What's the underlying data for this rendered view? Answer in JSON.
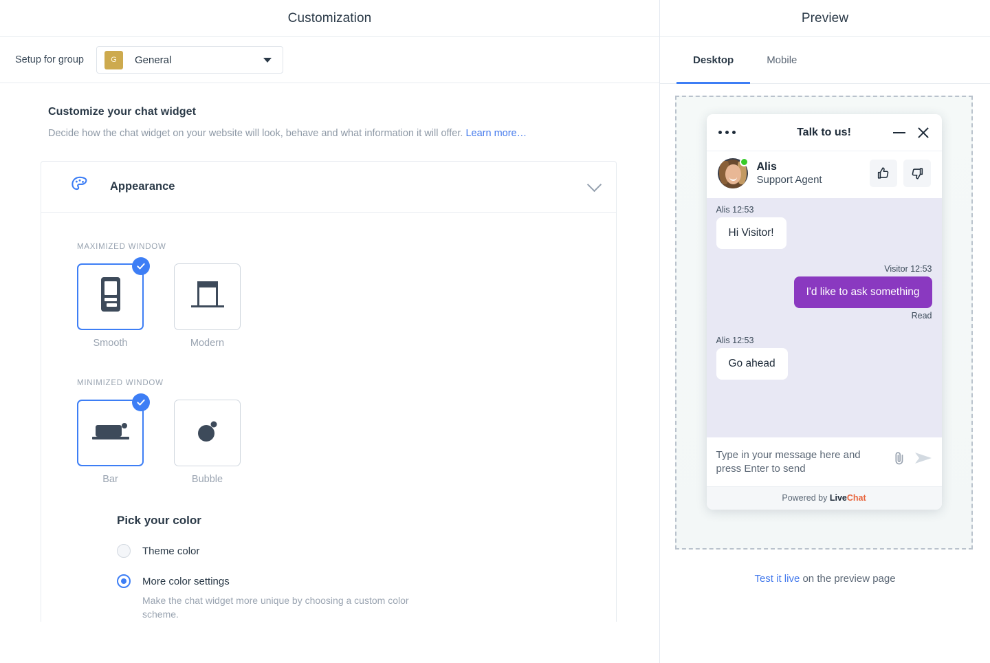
{
  "left": {
    "pane_title": "Customization",
    "group": {
      "label": "Setup for group",
      "badge": "G",
      "value": "General",
      "caret_icon": "chevron-down-icon"
    },
    "section": {
      "heading": "Customize your chat widget",
      "description": "Decide how the chat widget on your website will look, behave and what information it will offer.",
      "learn_more": "Learn more…"
    },
    "appearance_card": {
      "icon": "palette-icon",
      "title": "Appearance",
      "collapse_icon": "chevron-down-icon",
      "maximized": {
        "label": "MAXIMIZED WINDOW",
        "options": [
          {
            "caption": "Smooth",
            "icon": "smooth-window-icon",
            "selected": true
          },
          {
            "caption": "Modern",
            "icon": "modern-window-icon",
            "selected": false
          }
        ]
      },
      "minimized": {
        "label": "MINIMIZED WINDOW",
        "options": [
          {
            "caption": "Bar",
            "icon": "bar-minimized-icon",
            "selected": true
          },
          {
            "caption": "Bubble",
            "icon": "bubble-minimized-icon",
            "selected": false
          }
        ]
      },
      "pick_color": {
        "title": "Pick your color",
        "options": [
          {
            "label": "Theme color",
            "selected": false,
            "help": ""
          },
          {
            "label": "More color settings",
            "selected": true,
            "help": "Make the chat widget more unique by choosing a custom color scheme."
          }
        ]
      }
    }
  },
  "right": {
    "pane_title": "Preview",
    "tabs": [
      {
        "label": "Desktop",
        "active": true
      },
      {
        "label": "Mobile",
        "active": false
      }
    ],
    "widget": {
      "menu_icon": "more-options-icon",
      "title": "Talk to us!",
      "minimize_icon": "minimize-icon",
      "close_icon": "close-icon",
      "agent": {
        "avatar": "agent-avatar",
        "status": "online",
        "name": "Alis",
        "role": "Support Agent",
        "thumbs_up_icon": "thumbs-up-icon",
        "thumbs_down_icon": "thumbs-down-icon"
      },
      "messages": [
        {
          "side": "agent",
          "meta": "Alis 12:53",
          "text": "Hi Visitor!",
          "status": ""
        },
        {
          "side": "visitor",
          "meta": "Visitor 12:53",
          "text": "I'd like to ask something",
          "status": "Read"
        },
        {
          "side": "agent",
          "meta": "Alis 12:53",
          "text": "Go ahead",
          "status": ""
        }
      ],
      "composer": {
        "placeholder": "Type in your message here and press Enter to send",
        "attach_icon": "paperclip-icon",
        "send_icon": "send-icon"
      },
      "powered": {
        "prefix": "Powered by ",
        "brand_dark": "Live",
        "brand_accent": "Chat"
      }
    },
    "test_live": {
      "link": "Test it live",
      "rest": " on the preview page"
    }
  },
  "colors": {
    "accent_blue": "#3d7ef5",
    "link_blue": "#4379ec",
    "visitor_bubble_purple": "#8a39c0",
    "group_badge_gold": "#cdaa4e",
    "online_green": "#37cb28",
    "brand_orange": "#e8643c",
    "chat_bg": "#e8e8f4"
  }
}
